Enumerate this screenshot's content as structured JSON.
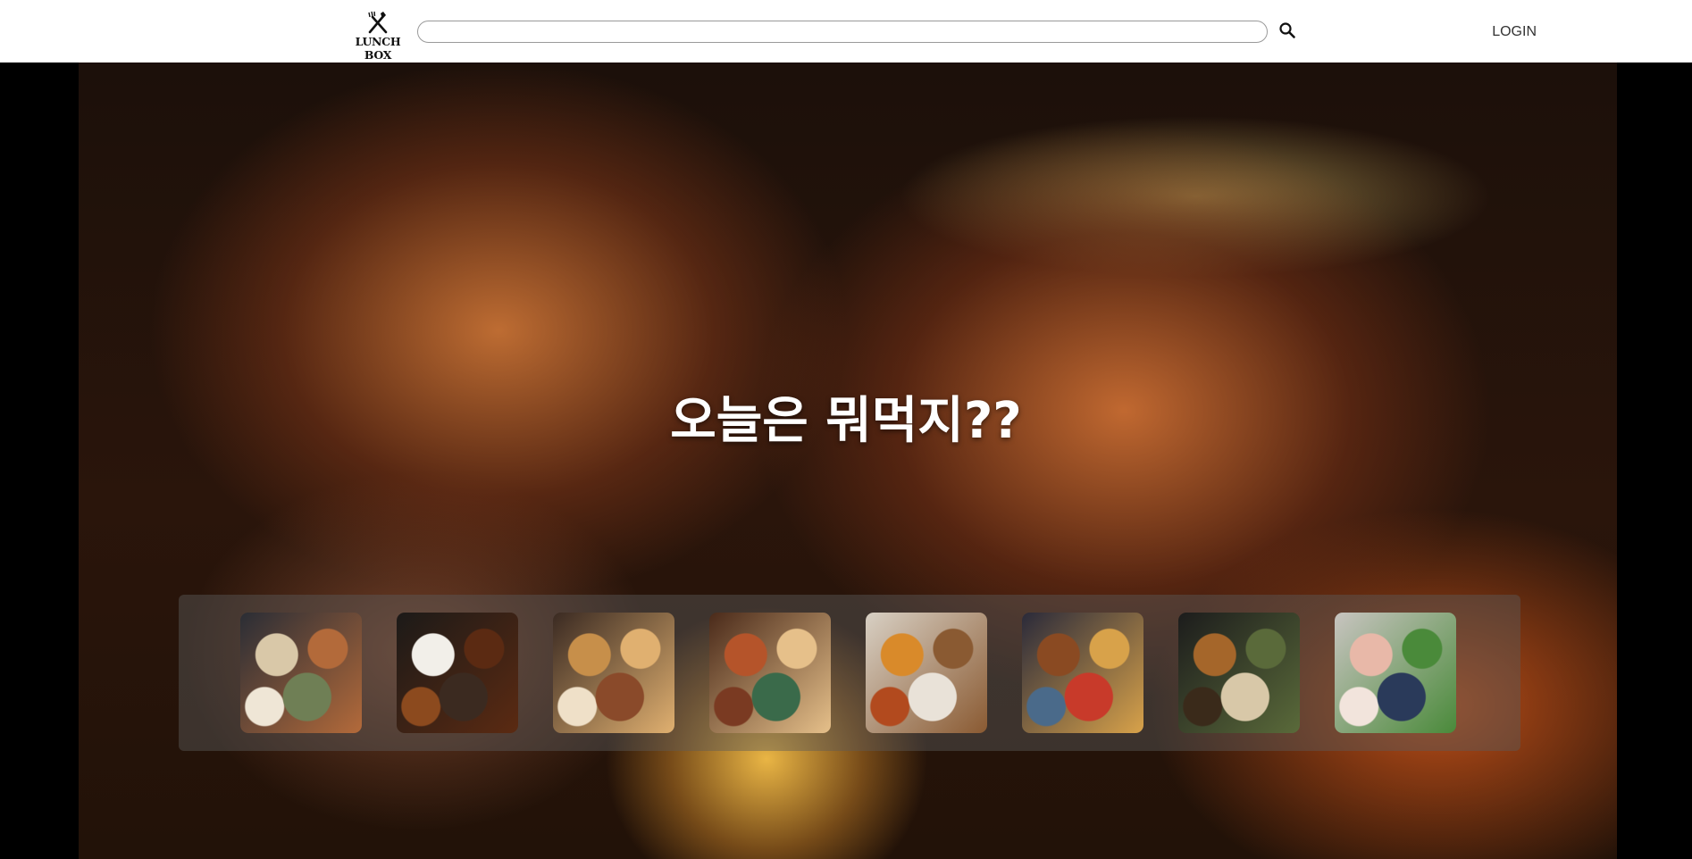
{
  "header": {
    "logo_text": "LUNCH BOX",
    "search_placeholder": "",
    "login_label": "LOGIN"
  },
  "hero": {
    "title": "오늘은 뭐먹지??"
  },
  "carousel": {
    "items": [
      {
        "icon": "korean-set-meal-thumbnail",
        "colors": [
          "#2a2d35",
          "#d9c8a8",
          "#b36a3a",
          "#6f7f55",
          "#efe6d6"
        ]
      },
      {
        "icon": "jajangmyeon-thumbnail",
        "colors": [
          "#1c1a18",
          "#f2efe9",
          "#5b2a12",
          "#3b2a20",
          "#8c4a1e"
        ]
      },
      {
        "icon": "pasta-shrimp-thumbnail",
        "colors": [
          "#3a2a22",
          "#c78f4a",
          "#e0b070",
          "#8a4a2a",
          "#efe0c8"
        ]
      },
      {
        "icon": "korean-pancake-thumbnail",
        "colors": [
          "#4a2a1a",
          "#b5542a",
          "#e6c08a",
          "#3a6a4a",
          "#7a3a22"
        ]
      },
      {
        "icon": "curry-thumbnail",
        "colors": [
          "#d8d0c4",
          "#d98a2a",
          "#8a5a32",
          "#e9e2d8",
          "#b24a1e"
        ]
      },
      {
        "icon": "burger-fries-thumbnail",
        "colors": [
          "#2a2a3a",
          "#8a4a22",
          "#d8a24a",
          "#c83a2a",
          "#4a6a8a"
        ]
      },
      {
        "icon": "spicy-noodle-soup-thumbnail",
        "colors": [
          "#1c1c1c",
          "#a5662a",
          "#5a6a3a",
          "#d8c8a8",
          "#3a2a1a"
        ]
      },
      {
        "icon": "samgyeopsal-thumbnail",
        "colors": [
          "#c8c4c0",
          "#e8b8a8",
          "#4a8a3a",
          "#2a3a5a",
          "#f2e4dc"
        ]
      }
    ]
  }
}
